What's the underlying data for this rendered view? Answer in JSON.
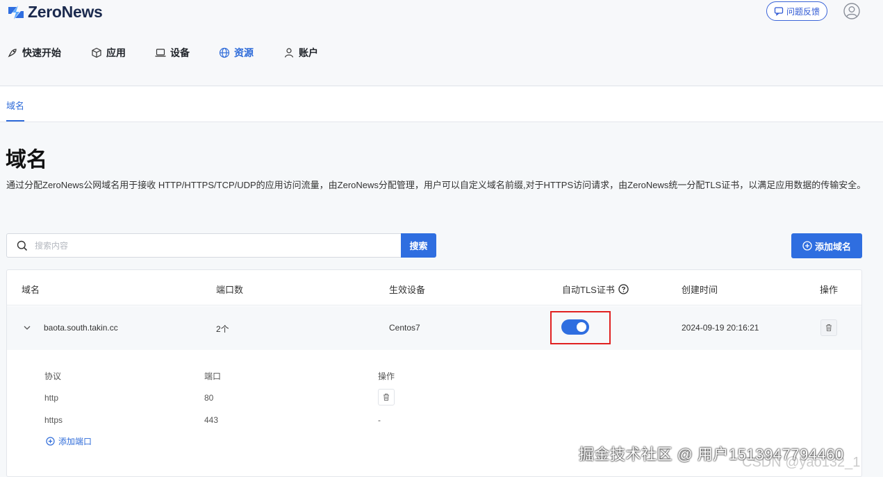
{
  "app": {
    "name": "ZeroNews"
  },
  "header": {
    "feedback_label": "问题反馈"
  },
  "nav": {
    "items": [
      {
        "label": "快速开始",
        "icon": "rocket-icon"
      },
      {
        "label": "应用",
        "icon": "cube-icon"
      },
      {
        "label": "设备",
        "icon": "laptop-icon"
      },
      {
        "label": "资源",
        "icon": "globe-icon",
        "active": true
      },
      {
        "label": "账户",
        "icon": "user-icon"
      }
    ]
  },
  "subnav": {
    "tab": "域名"
  },
  "page": {
    "title": "域名",
    "description": "通过分配ZeroNews公网域名用于接收 HTTP/HTTPS/TCP/UDP的应用访问流量，由ZeroNews分配管理，用户可以自定义域名前缀,对于HTTPS访问请求，由ZeroNews统一分配TLS证书，以满足应用数据的传输安全。"
  },
  "search": {
    "placeholder": "搜索内容",
    "button_label": "搜索"
  },
  "add_domain_label": "添加域名",
  "table": {
    "headers": {
      "domain": "域名",
      "ports": "端口数",
      "device": "生效设备",
      "tls": "自动TLS证书",
      "created": "创建时间",
      "actions": "操作"
    },
    "rows": [
      {
        "domain": "baota.south.takin.cc",
        "ports": "2个",
        "device": "Centos7",
        "tls_enabled": true,
        "created": "2024-09-19 20:16:21",
        "detail": {
          "headers": {
            "protocol": "协议",
            "port": "端口",
            "actions": "操作"
          },
          "items": [
            {
              "protocol": "http",
              "port": "80",
              "action": ""
            },
            {
              "protocol": "https",
              "port": "443",
              "action": "-"
            }
          ],
          "add_port_label": "添加端口"
        }
      }
    ]
  },
  "watermark": {
    "text": "掘金技术社区 @ 用户1513947794460",
    "text2": "CSDN @yao132_1"
  },
  "colors": {
    "accent": "#2f6ee0",
    "highlight": "#e02020"
  }
}
